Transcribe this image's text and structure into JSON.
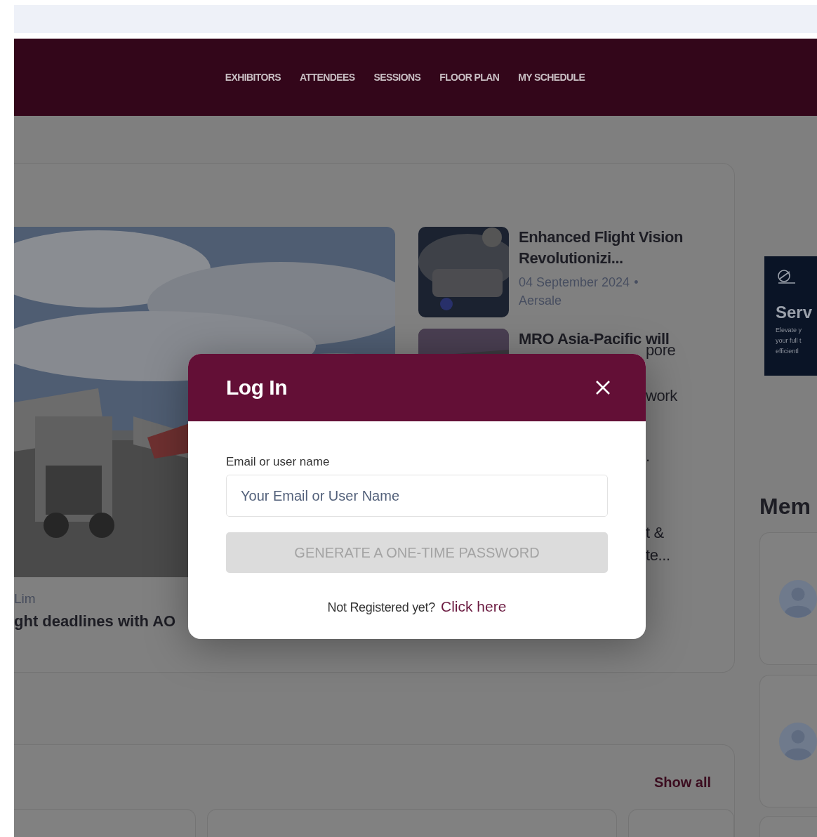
{
  "nav": {
    "items": [
      {
        "label": "EXHIBITORS"
      },
      {
        "label": "ATTENDEES"
      },
      {
        "label": "SESSIONS"
      },
      {
        "label": "FLOOR PLAN"
      },
      {
        "label": "MY SCHEDULE"
      }
    ]
  },
  "featured": {
    "main_article": {
      "author": "Lim",
      "title": "ght deadlines with AO"
    },
    "articles": [
      {
        "title": "Enhanced Flight Vision Revolutionizi...",
        "date": "04 September 2024",
        "separator": "•",
        "source": "Aersale"
      },
      {
        "title": "MRO Asia-Pacific will"
      }
    ],
    "covered_fragments": [
      "pore",
      "work",
      ".",
      "t &",
      "te..."
    ]
  },
  "ad": {
    "heading": "Serv",
    "lines": [
      "Elevate y",
      "your full t",
      "efficientl"
    ]
  },
  "members": {
    "heading": "Mem"
  },
  "news_section": {
    "show_all": "Show all"
  },
  "login_dialog": {
    "title": "Log In",
    "field": {
      "label": "Email or user name",
      "placeholder": "Your Email or User Name"
    },
    "submit": {
      "label": "GENERATE A ONE-TIME PASSWORD",
      "disabled": true
    },
    "footer": {
      "text": "Not Registered yet?",
      "link": "Click here"
    }
  }
}
